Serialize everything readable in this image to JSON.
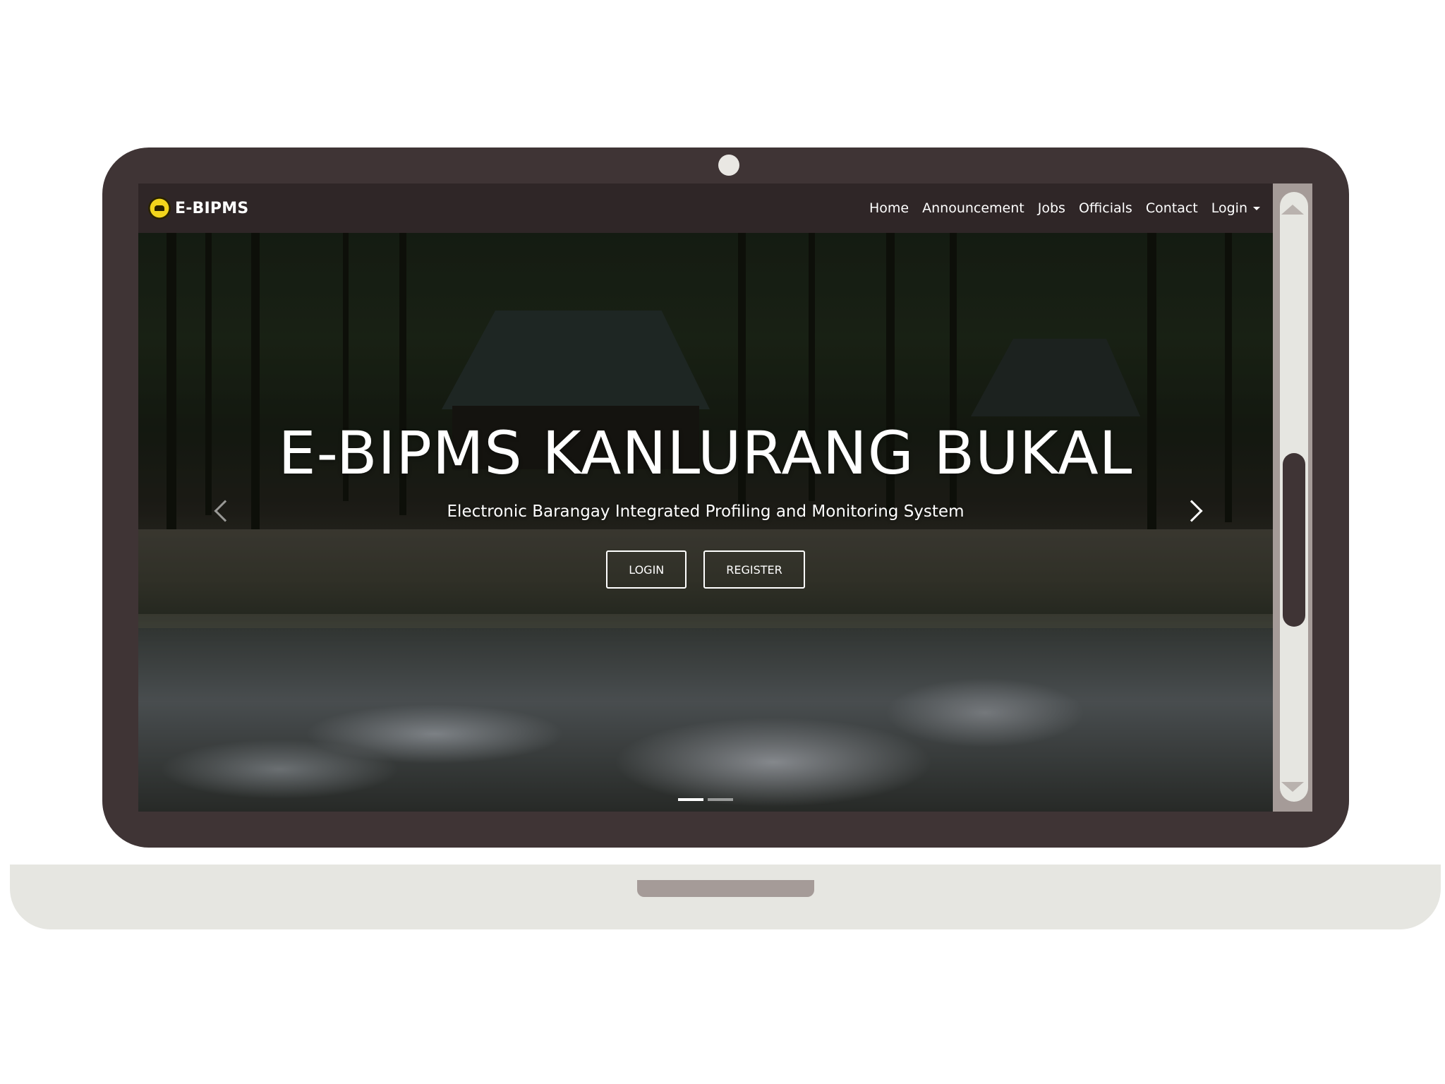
{
  "navbar": {
    "brand": "E-BIPMS",
    "logo_icon": "barangay-seal-icon",
    "links": [
      {
        "label": "Home"
      },
      {
        "label": "Announcement"
      },
      {
        "label": "Jobs"
      },
      {
        "label": "Officials"
      },
      {
        "label": "Contact"
      },
      {
        "label": "Login"
      }
    ]
  },
  "hero": {
    "title": "E-BIPMS KANLURANG BUKAL",
    "subtitle": "Electronic Barangay Integrated Profiling and Monitoring System",
    "login_button": "LOGIN",
    "register_button": "REGISTER",
    "slide_count": 2,
    "active_slide": 1
  },
  "colors": {
    "laptop_frame": "#3f3435",
    "laptop_base": "#e6e6e1",
    "navbar_bg": "#2f2627",
    "scrollbar_bg": "#a59b98",
    "scroll_thumb": "#3f3435"
  },
  "scroll": {
    "position_fraction": 0.45
  }
}
